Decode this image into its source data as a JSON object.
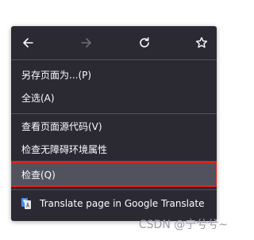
{
  "nav": {
    "back_icon": "arrow-left-icon",
    "forward_icon": "arrow-right-icon",
    "reload_icon": "reload-icon",
    "bookmark_icon": "star-icon"
  },
  "menu": {
    "items": [
      {
        "label": "另存页面为...(P)"
      },
      {
        "label": "全选(A)"
      },
      {
        "label": "查看页面源代码(V)"
      },
      {
        "label": "检查无障碍环境属性"
      },
      {
        "label": "检查(Q)",
        "highlighted": true
      },
      {
        "label": "Translate page in Google Translate",
        "icon": "google-translate-icon"
      }
    ]
  },
  "watermark": "CSDN @宁兮兮~",
  "colors": {
    "menu_bg": "#2b2a33",
    "highlight_bg": "#52525e",
    "highlight_border": "#e3211c",
    "text": "#fbfbfe"
  }
}
